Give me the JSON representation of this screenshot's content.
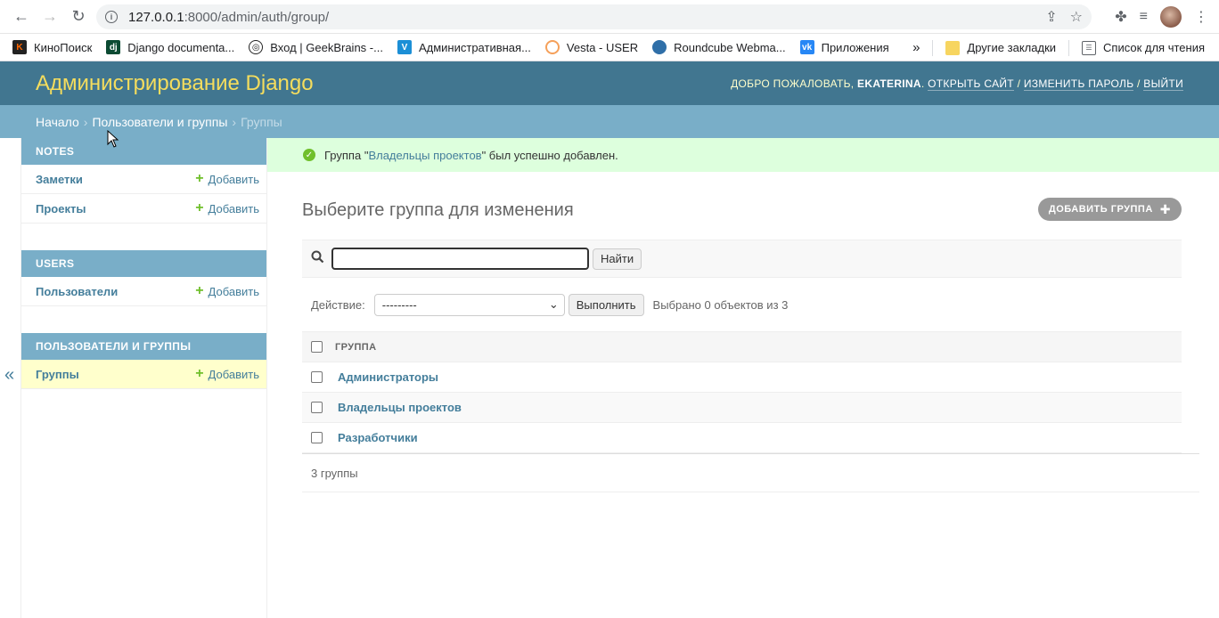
{
  "browser": {
    "url_host": "127.0.0.1",
    "url_rest": ":8000/admin/auth/group/"
  },
  "bookmarks": [
    {
      "label": "КиноПоиск",
      "icon": "kinopoisk-icon",
      "color": "#f60"
    },
    {
      "label": "Django documenta...",
      "icon": "django-icon",
      "color": "#0c4b33"
    },
    {
      "label": "Вход | GeekBrains -...",
      "icon": "geekbrains-icon",
      "color": "#222"
    },
    {
      "label": "Административная...",
      "icon": "v-icon",
      "color": "#1c8fd6"
    },
    {
      "label": "Vesta - USER",
      "icon": "vesta-icon",
      "color": "#f5a05a"
    },
    {
      "label": "Roundcube Webma...",
      "icon": "roundcube-icon",
      "color": "#2f6fa8"
    },
    {
      "label": "Приложения",
      "icon": "vk-icon",
      "color": "#2787f5"
    }
  ],
  "bookmarks_other": "Другие закладки",
  "reading_list": "Список для чтения",
  "header": {
    "branding": "Администрирование Django",
    "welcome": "Добро пожаловать,",
    "username": "EKATERINA",
    "view_site": "Открыть сайт",
    "change_password": "Изменить пароль",
    "logout": "Выйти"
  },
  "breadcrumbs": {
    "home": "Начало",
    "app": "Пользователи и группы",
    "current": "Группы"
  },
  "sidebar": {
    "modules": [
      {
        "caption": "NOTES",
        "rows": [
          {
            "label": "Заметки",
            "add": "Добавить"
          },
          {
            "label": "Проекты",
            "add": "Добавить"
          }
        ]
      },
      {
        "caption": "USERS",
        "rows": [
          {
            "label": "Пользователи",
            "add": "Добавить"
          }
        ]
      },
      {
        "caption": "Пользователи и группы",
        "rows": [
          {
            "label": "Группы",
            "add": "Добавить"
          }
        ]
      }
    ]
  },
  "message": {
    "prefix": "Группа \"",
    "link": "Владельцы проектов",
    "suffix": "\" был успешно добавлен."
  },
  "content": {
    "title": "Выберите группа для изменения",
    "add_button": "Добавить группа",
    "search_button": "Найти",
    "action_label": "Действие:",
    "action_value": "---------",
    "execute_button": "Выполнить",
    "selected_counter": "Выбрано 0 объектов из 3",
    "column_header": "Группа",
    "rows": [
      "Администраторы",
      "Владельцы проектов",
      "Разработчики"
    ],
    "paginator": "3 группы"
  }
}
